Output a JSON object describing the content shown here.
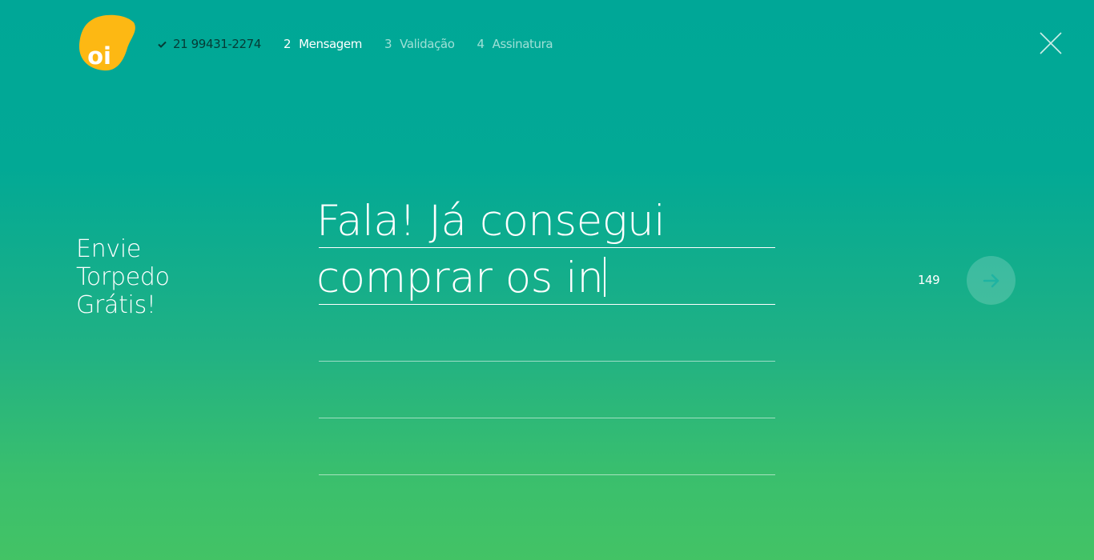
{
  "brand": {
    "logo_text": "oi",
    "logo_color": "#fdb813"
  },
  "steps": [
    {
      "status": "done",
      "label": "21 99431-2274"
    },
    {
      "status": "active",
      "number": "2",
      "label": "Mensagem"
    },
    {
      "status": "future",
      "number": "3",
      "label": "Validação"
    },
    {
      "status": "future",
      "number": "4",
      "label": "Assinatura"
    }
  ],
  "headline": {
    "line1": "Envie",
    "line2": "Torpedo",
    "line3": "Grátis!"
  },
  "message": {
    "lines": [
      "Fala! Já consegui",
      "comprar os in",
      "",
      "",
      ""
    ]
  },
  "char_counter": "149",
  "icons": {
    "close": "close-icon",
    "next": "arrow-right-icon",
    "done": "check-icon"
  },
  "colors": {
    "background_top": "#00a797",
    "background_bottom": "#43c365",
    "next_arrow": "#1fb3a2"
  }
}
